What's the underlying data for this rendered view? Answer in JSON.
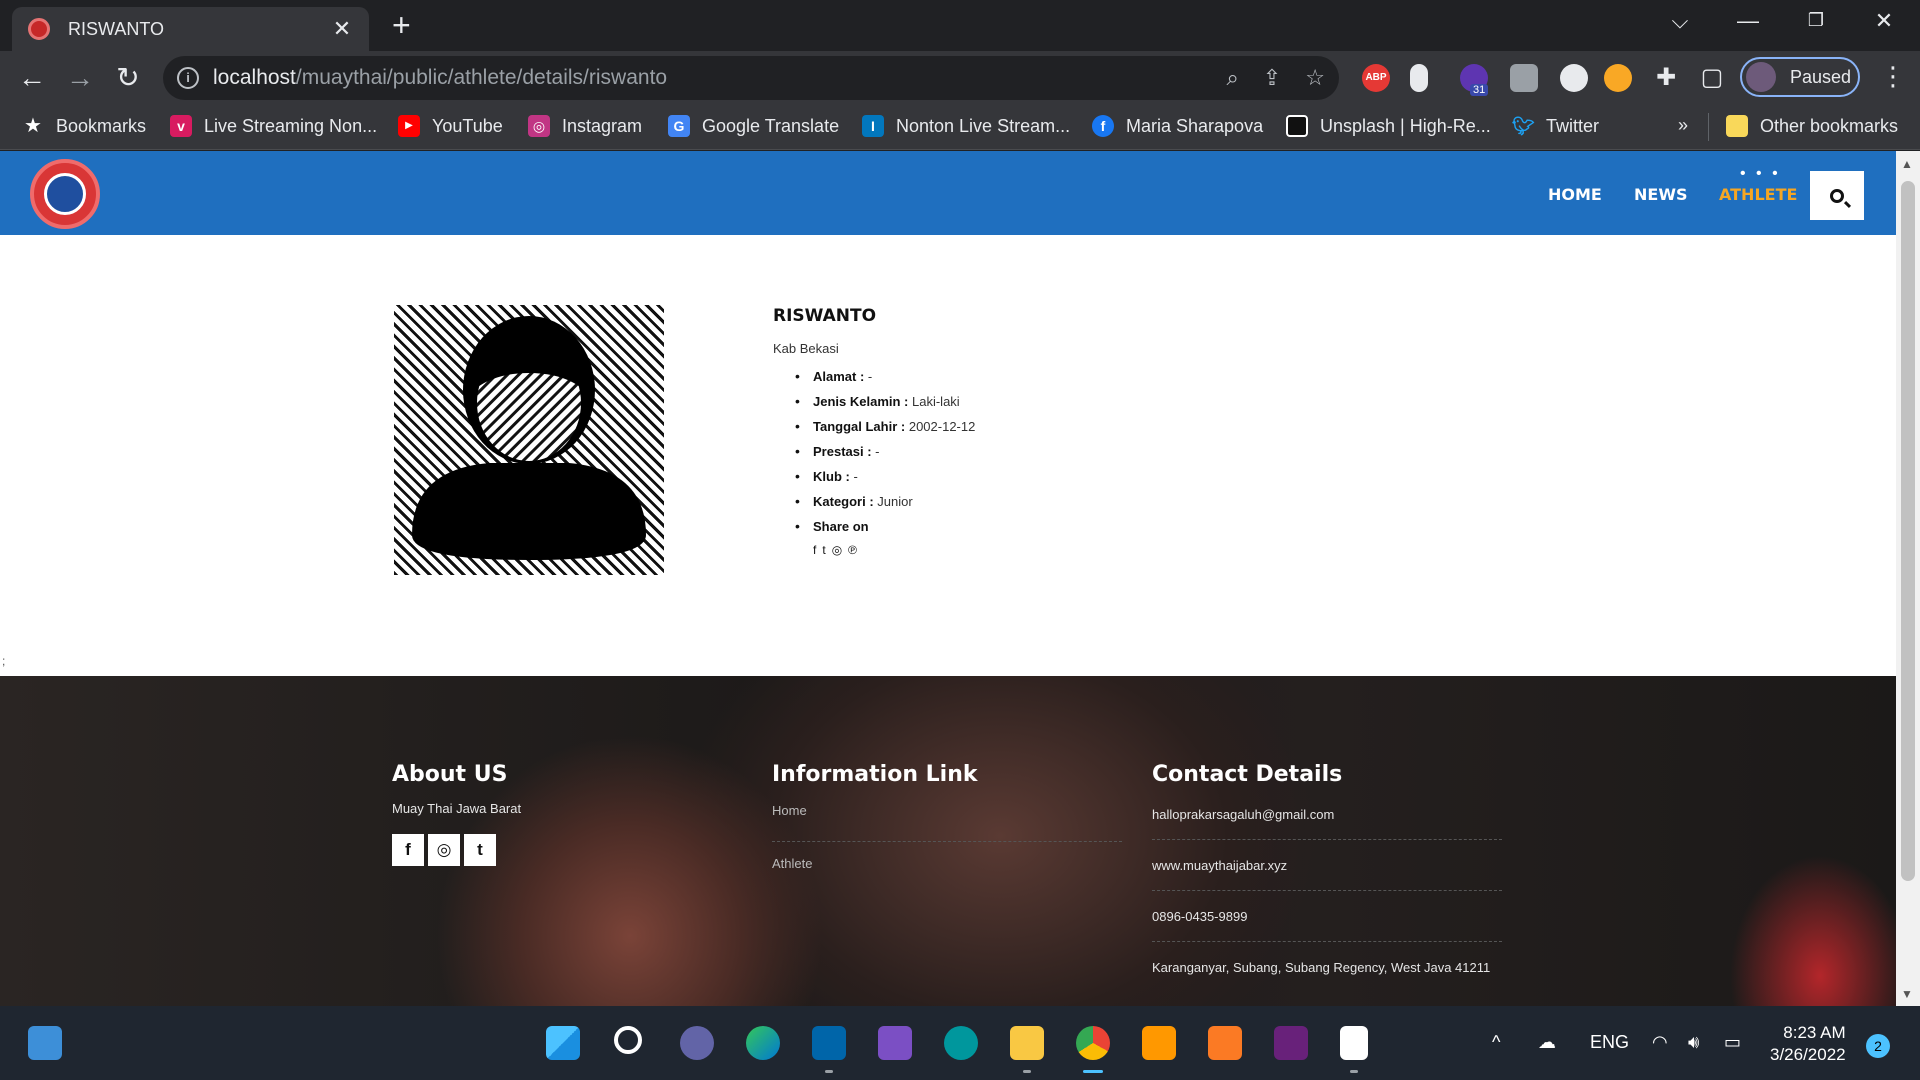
{
  "browser": {
    "tab_title": "RISWANTO",
    "url_host": "localhost",
    "url_path": "/muaythai/public/athlete/details/riswanto",
    "profile_label": "Paused",
    "bookmarks": [
      "Bookmarks",
      "Live Streaming Non...",
      "YouTube",
      "Instagram",
      "Google Translate",
      "Nonton Live Stream...",
      "Maria Sharapova",
      "Unsplash | High-Re...",
      "Twitter"
    ],
    "other_bookmarks": "Other bookmarks",
    "overflow": "»",
    "extension_badge": "31",
    "abp": "ABP"
  },
  "site": {
    "nav": [
      "HOME",
      "NEWS",
      "ATHLETE"
    ],
    "nav_dots": "• • •"
  },
  "athlete": {
    "name": "RISWANTO",
    "region": "Kab Bekasi",
    "details": [
      {
        "label": "Alamat :",
        "value": "-"
      },
      {
        "label": "Jenis Kelamin :",
        "value": "Laki-laki"
      },
      {
        "label": "Tanggal Lahir :",
        "value": "2002-12-12"
      },
      {
        "label": "Prestasi :",
        "value": "-"
      },
      {
        "label": "Klub :",
        "value": "-"
      },
      {
        "label": "Kategori :",
        "value": "Junior"
      },
      {
        "label": "Share on",
        "value": ""
      }
    ],
    "share_icons": [
      "f",
      "t",
      "◎",
      "℗"
    ]
  },
  "stray_text": ";",
  "footer": {
    "about_title": "About US",
    "about_text": "Muay Thai Jawa Barat",
    "social": [
      "f",
      "◎",
      "t"
    ],
    "info_title": "Information Link",
    "info_links": [
      "Home",
      "Athlete"
    ],
    "contact_title": "Contact Details",
    "contacts": [
      "halloprakarsagaluh@gmail.com",
      "www.muaythaijabar.xyz",
      "0896-0435-9899",
      "Karanganyar, Subang, Subang Regency, West Java 41211"
    ]
  },
  "taskbar": {
    "language": "ENG",
    "time": "8:23 AM",
    "date": "3/26/2022",
    "notifications": "2"
  },
  "colors": {
    "header_blue": "#1f6fbf",
    "nav_active": "#f5a623"
  }
}
